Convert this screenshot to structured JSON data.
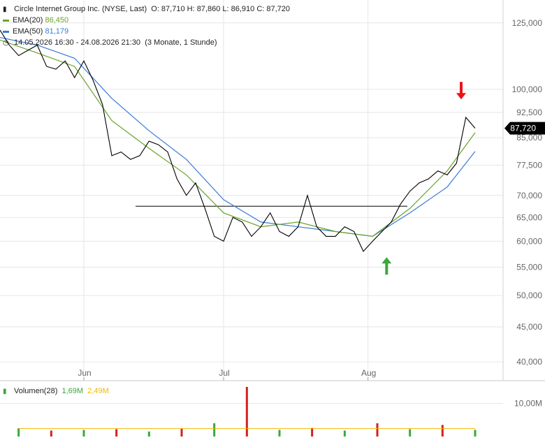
{
  "header": {
    "title": "Circle Internet Group Inc. (NYSE, Last)",
    "ohlc": "O: 87,710   H: 87,860   L: 86,910   C: 87,720",
    "ema20_label": "EMA(20)",
    "ema20_value": "86,450",
    "ema50_label": "EMA(50)",
    "ema50_value": "81,179",
    "range_label": "14.05.2026 16:30 - 24.08.2026 21:30",
    "range_note": "(3 Monate, 1 Stunde)"
  },
  "colors": {
    "price": "#000000",
    "ema20": "#6aa32a",
    "ema50": "#3a7bd5",
    "last_badge_bg": "#000000",
    "down_arrow": "#e8141c",
    "up_arrow": "#3aa83a",
    "vol_up": "#3aa83a",
    "vol_down": "#d42020",
    "vol_avg": "#f2b705",
    "grid": "#e6e6e6"
  },
  "chart_data": [
    {
      "type": "line",
      "title": "Circle Internet Group Inc. (NYSE, Last)",
      "scale": "log",
      "ylim": [
        38000,
        135000
      ],
      "xlim": [
        "2026-05-14",
        "2026-08-30"
      ],
      "y_ticks": [
        "125,000",
        "100,000",
        "92,500",
        "85,000",
        "77,500",
        "70,000",
        "65,000",
        "60,000",
        "55,000",
        "50,000",
        "45,000",
        "40,000"
      ],
      "y_tick_values": [
        125000,
        100000,
        92500,
        85000,
        77500,
        70000,
        65000,
        60000,
        55000,
        50000,
        45000,
        40000
      ],
      "x_ticks": [
        "Jun",
        "Jul",
        "Aug"
      ],
      "x_tick_values": [
        "2026-06-01",
        "2026-07-01",
        "2026-08-01"
      ],
      "last_value_label": "87,720",
      "horizontal_line": 67500,
      "series": [
        {
          "name": "Circle Internet Group Inc.",
          "x": [
            "2026-05-14",
            "2026-05-16",
            "2026-05-18",
            "2026-05-20",
            "2026-05-22",
            "2026-05-24",
            "2026-05-26",
            "2026-05-28",
            "2026-05-30",
            "2026-06-01",
            "2026-06-03",
            "2026-06-05",
            "2026-06-07",
            "2026-06-09",
            "2026-06-11",
            "2026-06-13",
            "2026-06-15",
            "2026-06-17",
            "2026-06-19",
            "2026-06-21",
            "2026-06-23",
            "2026-06-25",
            "2026-06-27",
            "2026-06-29",
            "2026-07-01",
            "2026-07-03",
            "2026-07-05",
            "2026-07-07",
            "2026-07-09",
            "2026-07-11",
            "2026-07-13",
            "2026-07-15",
            "2026-07-17",
            "2026-07-19",
            "2026-07-21",
            "2026-07-23",
            "2026-07-25",
            "2026-07-27",
            "2026-07-29",
            "2026-07-31",
            "2026-08-02",
            "2026-08-04",
            "2026-08-06",
            "2026-08-08",
            "2026-08-10",
            "2026-08-12",
            "2026-08-14",
            "2026-08-16",
            "2026-08-18",
            "2026-08-20",
            "2026-08-22",
            "2026-08-24"
          ],
          "values": [
            122000,
            116000,
            112000,
            114000,
            116000,
            108000,
            107000,
            110000,
            104000,
            110000,
            103000,
            95000,
            80000,
            81000,
            79000,
            80000,
            84000,
            83000,
            81000,
            74000,
            70000,
            73000,
            67000,
            61000,
            60000,
            65000,
            64000,
            61000,
            63000,
            66000,
            62000,
            61000,
            63000,
            70000,
            63000,
            61000,
            61000,
            63000,
            62000,
            58000,
            60000,
            62000,
            64000,
            68000,
            71000,
            73000,
            74000,
            76000,
            75000,
            78000,
            91000,
            87720
          ]
        },
        {
          "name": "EMA(20)",
          "x": [
            "2026-05-14",
            "2026-05-22",
            "2026-05-30",
            "2026-06-07",
            "2026-06-15",
            "2026-06-23",
            "2026-07-01",
            "2026-07-09",
            "2026-07-17",
            "2026-07-25",
            "2026-08-02",
            "2026-08-10",
            "2026-08-18",
            "2026-08-24"
          ],
          "values": [
            118000,
            113000,
            108000,
            90000,
            82000,
            75000,
            66000,
            63000,
            64000,
            62000,
            61000,
            67000,
            76000,
            86450
          ]
        },
        {
          "name": "EMA(50)",
          "x": [
            "2026-05-14",
            "2026-05-22",
            "2026-05-30",
            "2026-06-07",
            "2026-06-15",
            "2026-06-23",
            "2026-07-01",
            "2026-07-09",
            "2026-07-17",
            "2026-07-25",
            "2026-08-02",
            "2026-08-10",
            "2026-08-18",
            "2026-08-24"
          ],
          "values": [
            119000,
            116000,
            111000,
            97000,
            87000,
            79000,
            69000,
            64000,
            63000,
            62000,
            61000,
            66000,
            72000,
            81179
          ]
        }
      ]
    },
    {
      "type": "bar",
      "title": "Volumen(28)",
      "subtitle_values": [
        "1,69M",
        "2,49M"
      ],
      "y_ticks": [
        "10,00M"
      ],
      "y_tick_values": [
        10000000
      ],
      "ylim": [
        0,
        15000000
      ],
      "x": [
        "2026-05-18",
        "2026-05-25",
        "2026-06-01",
        "2026-06-08",
        "2026-06-15",
        "2026-06-22",
        "2026-06-29",
        "2026-07-06",
        "2026-07-13",
        "2026-07-20",
        "2026-07-27",
        "2026-08-03",
        "2026-08-10",
        "2026-08-17",
        "2026-08-24"
      ],
      "values": [
        2500000,
        1800000,
        2000000,
        2200000,
        1500000,
        2400000,
        4000000,
        15000000,
        2000000,
        2600000,
        1800000,
        4000000,
        2200000,
        3500000,
        2000000
      ]
    }
  ]
}
